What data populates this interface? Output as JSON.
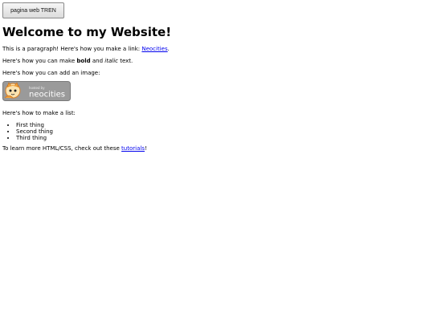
{
  "button": {
    "label": "pagina web TREN"
  },
  "heading": "Welcome to my Website!",
  "paragraph1": {
    "text": "This is a paragraph! Here's how you make a link: ",
    "link_text": "Neocities",
    "suffix": "."
  },
  "paragraph2": {
    "prefix": "Here's how you can make ",
    "bold": "bold",
    "middle": " and ",
    "italic": "italic",
    "suffix": " text."
  },
  "paragraph3": "Here's how you can add an image:",
  "badge": {
    "small_text": "hosted by",
    "brand_text": "neocities",
    "background": "#9a9a9a",
    "accent": "#f2a33a"
  },
  "paragraph4": "Here's how to make a list:",
  "list": [
    "First thing",
    "Second thing",
    "Third thing"
  ],
  "paragraph5": {
    "text": "To learn more HTML/CSS, check out these ",
    "link_text": "tutorials",
    "suffix": "!"
  },
  "colors": {
    "link": "#0000ee",
    "text": "#000000",
    "background": "#ffffff"
  }
}
